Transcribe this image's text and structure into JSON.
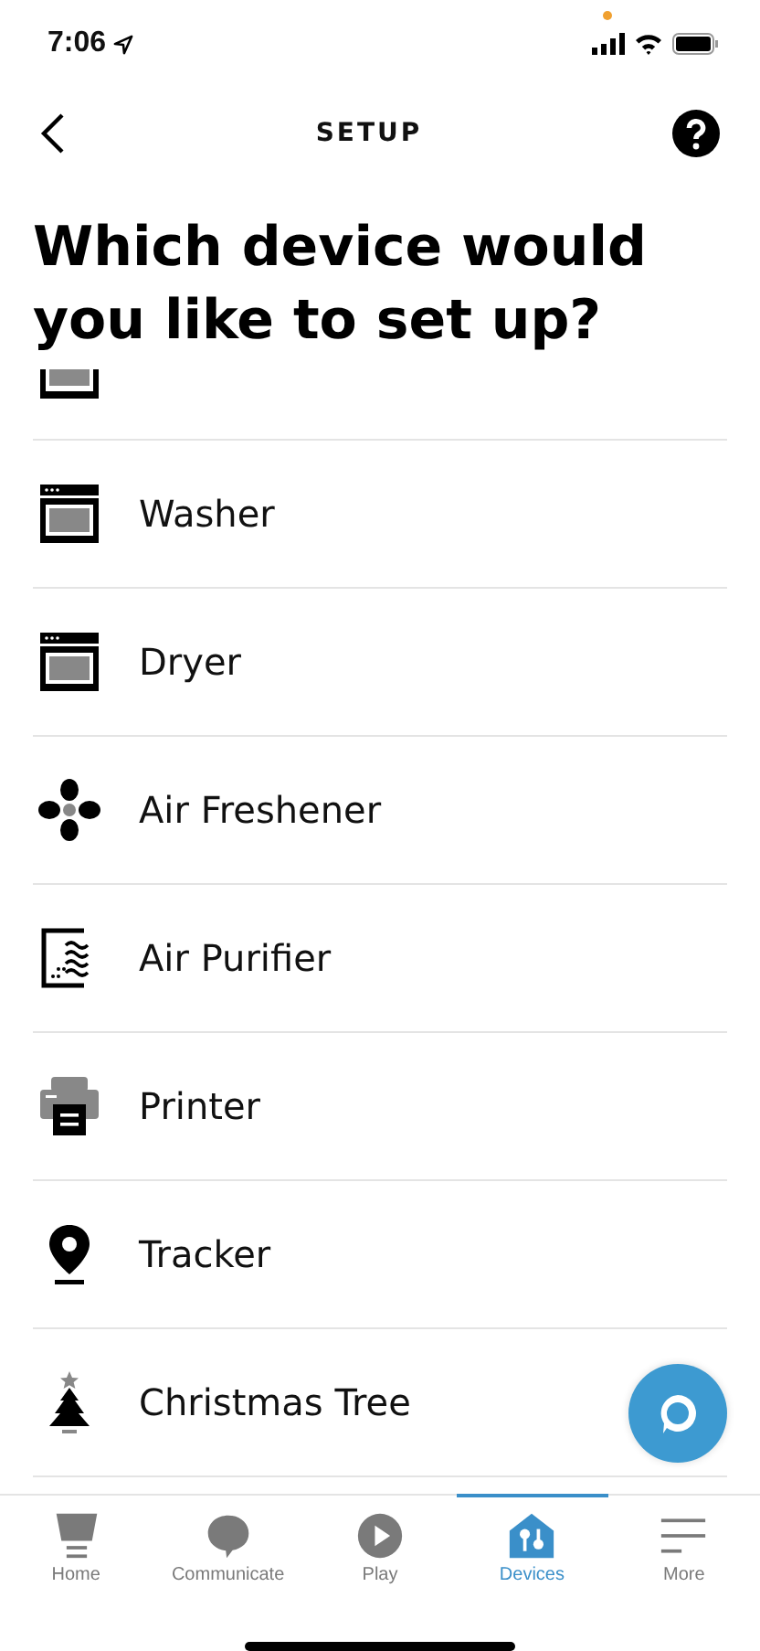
{
  "status_bar": {
    "time": "7:06"
  },
  "nav": {
    "title": "SETUP"
  },
  "heading": "Which device would you like to set up?",
  "devices": [
    {
      "kind": "appliance"
    },
    {
      "label": "Washer",
      "kind": "laundry"
    },
    {
      "label": "Dryer",
      "kind": "laundry"
    },
    {
      "label": "Air Freshener",
      "kind": "fan"
    },
    {
      "label": "Air Purifier",
      "kind": "purifier"
    },
    {
      "label": "Printer",
      "kind": "printer"
    },
    {
      "label": "Tracker",
      "kind": "pin"
    },
    {
      "label": "Christmas Tree",
      "kind": "tree"
    }
  ],
  "tabs": [
    {
      "label": "Home",
      "kind": "home",
      "selected": false
    },
    {
      "label": "Communicate",
      "kind": "chat",
      "selected": false
    },
    {
      "label": "Play",
      "kind": "play",
      "selected": false
    },
    {
      "label": "Devices",
      "kind": "devices",
      "selected": true
    },
    {
      "label": "More",
      "kind": "more",
      "selected": false
    }
  ]
}
